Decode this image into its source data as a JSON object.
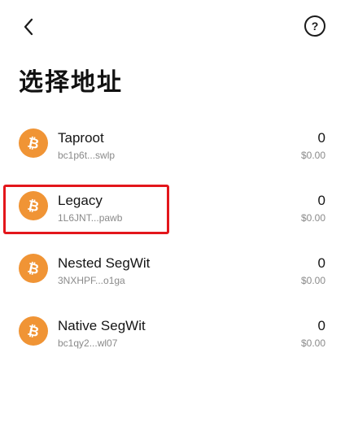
{
  "header": {
    "back_icon": "chevron-left-icon",
    "help_icon": "question-circle-icon",
    "help_glyph": "?"
  },
  "page": {
    "title": "选择地址"
  },
  "coin_icon": {
    "name": "bitcoin-icon",
    "color": "#f09435"
  },
  "highlight_color": "#e3161b",
  "addresses": [
    {
      "name": "Taproot",
      "address": "bc1p6t...swlp",
      "balance": "0",
      "fiat": "$0.00"
    },
    {
      "name": "Legacy",
      "address": "1L6JNT...pawb",
      "balance": "0",
      "fiat": "$0.00",
      "highlighted": true
    },
    {
      "name": "Nested SegWit",
      "address": "3NXHPF...o1ga",
      "balance": "0",
      "fiat": "$0.00"
    },
    {
      "name": "Native SegWit",
      "address": "bc1qy2...wl07",
      "balance": "0",
      "fiat": "$0.00"
    }
  ]
}
